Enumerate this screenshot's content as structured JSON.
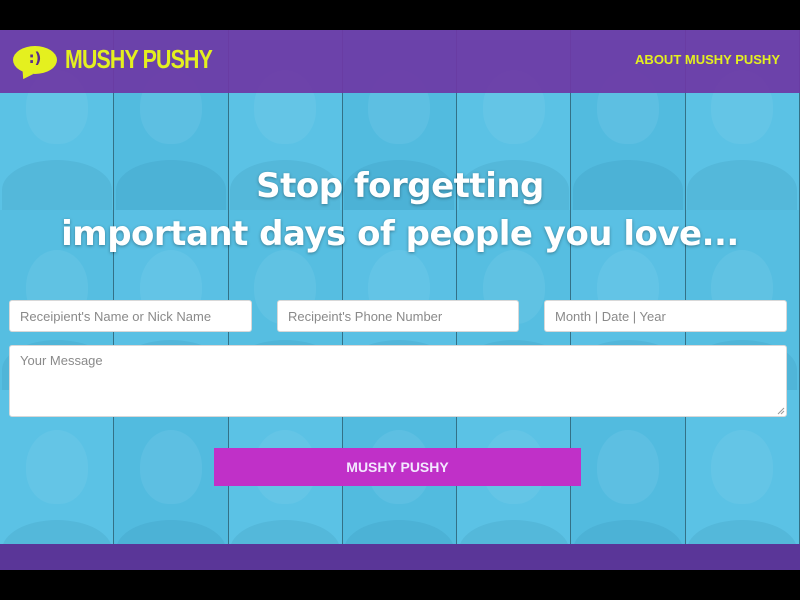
{
  "header": {
    "logo_face": ":)",
    "logo_text": "MUSHY PUSHY",
    "about_link": "ABOUT MUSHY PUSHY"
  },
  "headline": {
    "line1": "Stop forgetting",
    "line2": "important days of people you love..."
  },
  "form": {
    "name_placeholder": "Receipient's Name or Nick Name",
    "phone_placeholder": "Recipeint's Phone Number",
    "date_placeholder": "Month | Date | Year",
    "message_placeholder": "Your Message",
    "submit_label": "MUSHY PUSHY"
  },
  "colors": {
    "brand_purple": "#6e37a5",
    "brand_yellow": "#e4f01f",
    "button_magenta": "#c030c8",
    "background_cyan": "#4dbee6"
  },
  "icons": {
    "logo": "speech-bubble-smiley-icon",
    "resize": "resize-grip-icon"
  }
}
